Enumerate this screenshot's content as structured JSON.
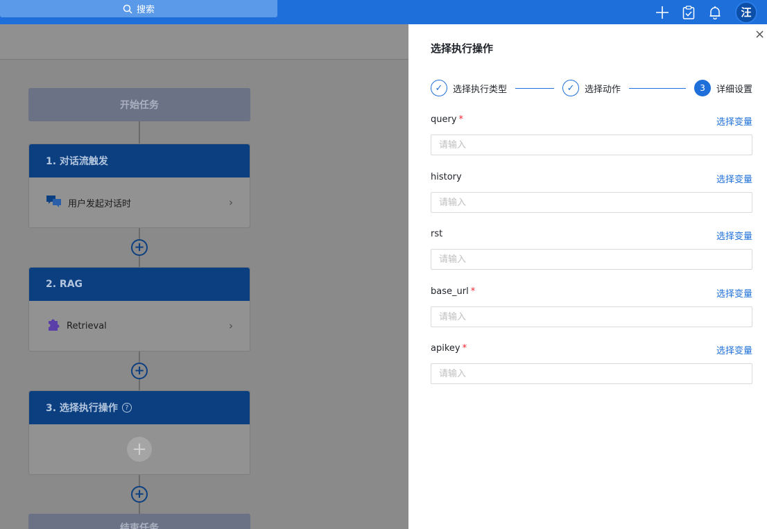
{
  "topbar": {
    "search_placeholder": "搜索",
    "avatar_text": "汪"
  },
  "flow": {
    "start_label": "开始任务",
    "steps": [
      {
        "title": "1. 对话流触发",
        "item": "用户发起对话时"
      },
      {
        "title": "2. RAG",
        "item": "Retrieval"
      },
      {
        "title": "3. 选择执行操作"
      }
    ],
    "end_label": "结束任务",
    "plus_glyph": "+",
    "chevron_glyph": "›",
    "help_glyph": "?"
  },
  "drawer": {
    "title": "选择执行操作",
    "close_glyph": "×",
    "steps": [
      {
        "label": "选择执行类型",
        "mark": "✓"
      },
      {
        "label": "选择动作",
        "mark": "✓"
      },
      {
        "label": "详细设置",
        "mark": "3"
      }
    ],
    "fields": [
      {
        "label": "query",
        "required": "*",
        "link": "选择变量",
        "placeholder": "请输入"
      },
      {
        "label": "history",
        "required": "",
        "link": "选择变量",
        "placeholder": "请输入"
      },
      {
        "label": "rst",
        "required": "",
        "link": "选择变量",
        "placeholder": "请输入"
      },
      {
        "label": "base_url",
        "required": "*",
        "link": "选择变量",
        "placeholder": "请输入"
      },
      {
        "label": "apikey",
        "required": "*",
        "link": "选择变量",
        "placeholder": "请输入"
      }
    ]
  },
  "colors": {
    "primary": "#1e6fd9",
    "card_header": "#0b3f80",
    "required": "#f5222d"
  }
}
